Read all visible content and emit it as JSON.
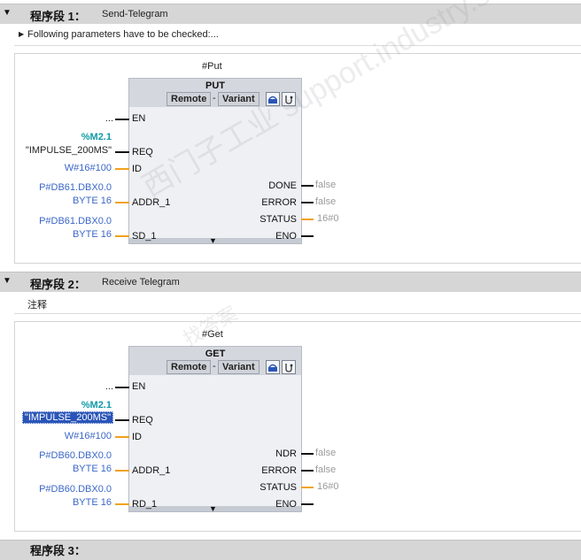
{
  "networks": [
    {
      "number": "程序段 1：",
      "title": "Send-Telegram",
      "comment": "Following parameters have to be checked:...",
      "instance": "#Put",
      "block": "PUT",
      "chip_left": "Remote",
      "chip_sep": "-",
      "chip_right": "Variant",
      "en_input": "...",
      "en": "EN",
      "req_addr": "%M2.1",
      "req_sym": "\"IMPULSE_200MS\"",
      "req": "REQ",
      "id_val": "W#16#100",
      "id": "ID",
      "addr_val1": "P#DB61.DBX0.0",
      "addr_val2": "BYTE 16",
      "addr": "ADDR_1",
      "data_val1": "P#DB61.DBX0.0",
      "data_val2": "BYTE 16",
      "data": "SD_1",
      "out1": "DONE",
      "out1_val": "false",
      "out2": "ERROR",
      "out2_val": "false",
      "out3": "STATUS",
      "out3_val": "16#0",
      "eno": "ENO"
    },
    {
      "number": "程序段 2：",
      "title": "Receive Telegram",
      "comment": "注释",
      "instance": "#Get",
      "block": "GET",
      "chip_left": "Remote",
      "chip_sep": "-",
      "chip_right": "Variant",
      "en_input": "...",
      "en": "EN",
      "req_addr": "%M2.1",
      "req_sym": "\"IMPULSE_200MS\"",
      "req": "REQ",
      "id_val": "W#16#100",
      "id": "ID",
      "addr_val1": "P#DB60.DBX0.0",
      "addr_val2": "BYTE 16",
      "addr": "ADDR_1",
      "data_val1": "P#DB60.DBX0.0",
      "data_val2": "BYTE 16",
      "data": "RD_1",
      "out1": "NDR",
      "out1_val": "false",
      "out2": "ERROR",
      "out2_val": "false",
      "out3": "STATUS",
      "out3_val": "16#0",
      "eno": "ENO"
    }
  ],
  "network3_number": "程序段 3：",
  "watermark": "西门子工业 support.industry.siemens.com/cs",
  "watermark2": "找答案",
  "colors": {
    "header_bg": "#d6d6d6",
    "block_bg": "#eef0f4",
    "wire_bool": "#111111",
    "wire_other": "#f0a21a",
    "operand_blue": "#3b67c8",
    "operand_teal": "#0e9aa7",
    "selection": "#2a55b8"
  }
}
